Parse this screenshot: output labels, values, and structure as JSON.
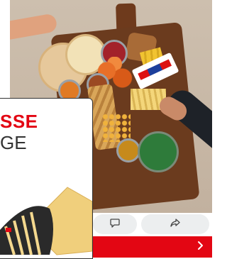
{
  "ad": {
    "headline_line1": "SSE",
    "headline_line2": "GE"
  },
  "actions": {
    "comment_icon": "comment-icon",
    "share_icon": "share-icon"
  },
  "cta": {
    "icon": "chevron-right-icon",
    "color": "#e30613"
  },
  "colors": {
    "accent": "#e30613",
    "pill_bg": "#eceeef"
  }
}
